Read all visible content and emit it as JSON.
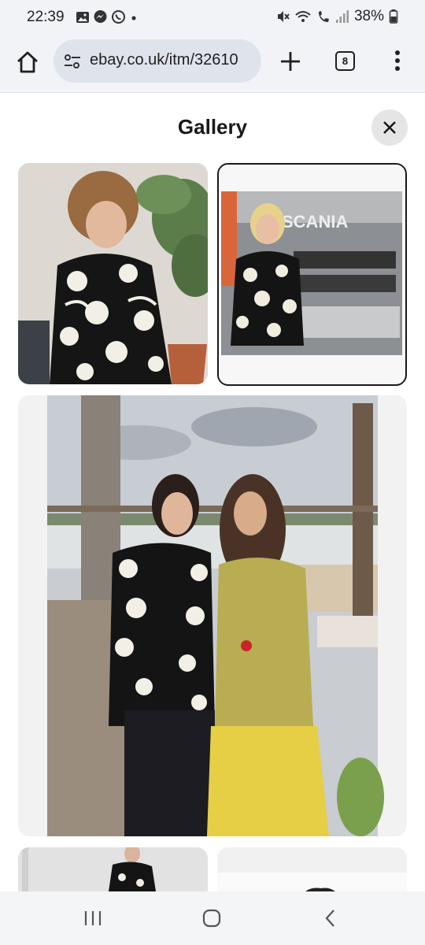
{
  "status_bar": {
    "time": "22:39",
    "battery": "38%",
    "notification_icons": [
      "gallery-icon",
      "messenger-icon",
      "whatsapp-icon",
      "dot-icon"
    ],
    "system_icons": [
      "mute-icon",
      "wifi-icon",
      "wifi-call-icon",
      "signal-icon",
      "battery-icon"
    ]
  },
  "browser": {
    "url": "ebay.co.uk/itm/32610",
    "tab_count": "8"
  },
  "gallery": {
    "title": "Gallery",
    "close_label": "✕",
    "images": [
      {
        "description_icon": "jacket-photo-icon",
        "selected": false
      },
      {
        "description_icon": "truck-photo-icon",
        "selected": true
      },
      {
        "description_icon": "beach-photo-icon",
        "selected": false
      },
      {
        "description_icon": "model-photo-icon",
        "selected": false
      },
      {
        "description_icon": "jacket-detail-photo-icon",
        "selected": false
      }
    ]
  },
  "colors": {
    "chrome_bg": "#f1f3f6",
    "url_bg": "#dfe3eb",
    "selected_border": "#191919"
  }
}
